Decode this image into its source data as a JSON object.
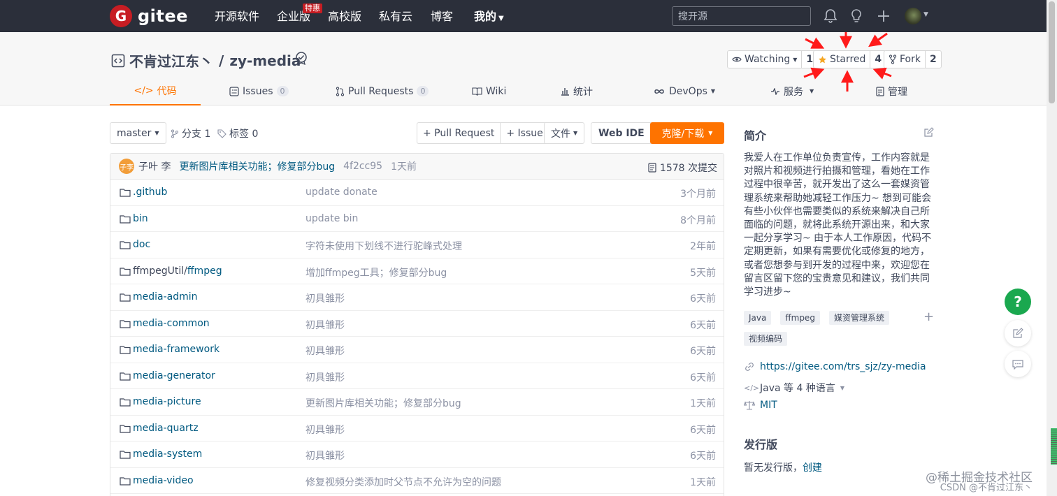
{
  "brand": {
    "logo_letter": "G",
    "name": "gitee"
  },
  "topnav": {
    "items": [
      "开源软件",
      "企业版",
      "高校版",
      "私有云",
      "博客",
      "我的"
    ],
    "badge": "特惠",
    "search_placeholder": "搜开源"
  },
  "repo": {
    "owner": "不肯过江东丶",
    "separator": "/",
    "name": "zy-media",
    "watching": {
      "label": "Watching",
      "count": "1"
    },
    "starred": {
      "label": "Starred",
      "count": "4"
    },
    "fork": {
      "label": "Fork",
      "count": "2"
    }
  },
  "tabs": [
    {
      "label": "代码",
      "count": ""
    },
    {
      "label": "Issues",
      "count": "0"
    },
    {
      "label": "Pull Requests",
      "count": "0"
    },
    {
      "label": "Wiki",
      "count": ""
    },
    {
      "label": "统计",
      "count": ""
    },
    {
      "label": "DevOps",
      "count": ""
    },
    {
      "label": "服务",
      "count": ""
    },
    {
      "label": "管理",
      "count": ""
    }
  ],
  "toolbar": {
    "branch": "master",
    "branches": "分支 1",
    "tags": "标签 0",
    "pull_request": "+ Pull Request",
    "issue": "+ Issue",
    "file": "文件",
    "web_ide": "Web IDE",
    "clone": "克隆/下载"
  },
  "commit": {
    "avatar_text": "子李",
    "author": "子叶 李",
    "message": "更新图片库相关功能；修复部分bug",
    "sha": "4f2cc95",
    "time": "1天前",
    "count": "1578 次提交"
  },
  "files": [
    {
      "name": ".github",
      "prefix": "",
      "message": "update donate",
      "time": "3个月前"
    },
    {
      "name": "bin",
      "prefix": "",
      "message": "update bin",
      "time": "8个月前"
    },
    {
      "name": "doc",
      "prefix": "",
      "message": "字符未使用下划线不进行驼峰式处理",
      "time": "2年前"
    },
    {
      "name": "ffmpeg",
      "prefix": "ffmpegUtil/",
      "message": "增加ffmpeg工具；修复部分bug",
      "time": "5天前"
    },
    {
      "name": "media-admin",
      "prefix": "",
      "message": "初具雏形",
      "time": "6天前"
    },
    {
      "name": "media-common",
      "prefix": "",
      "message": "初具雏形",
      "time": "6天前"
    },
    {
      "name": "media-framework",
      "prefix": "",
      "message": "初具雏形",
      "time": "6天前"
    },
    {
      "name": "media-generator",
      "prefix": "",
      "message": "初具雏形",
      "time": "6天前"
    },
    {
      "name": "media-picture",
      "prefix": "",
      "message": "更新图片库相关功能；修复部分bug",
      "time": "1天前"
    },
    {
      "name": "media-quartz",
      "prefix": "",
      "message": "初具雏形",
      "time": "6天前"
    },
    {
      "name": "media-system",
      "prefix": "",
      "message": "初具雏形",
      "time": "6天前"
    },
    {
      "name": "media-video",
      "prefix": "",
      "message": "修复视频分类添加时父节点不允许为空的问题",
      "time": "1天前"
    }
  ],
  "sidebar": {
    "intro_title": "简介",
    "description": "我爱人在工作单位负责宣传，工作内容就是对照片和视频进行拍摄和管理，看她在工作过程中很辛苦，就开发出了这么一套媒资管理系统来帮助她减轻工作压力~ 想到可能会有些小伙伴也需要类似的系统来解决自己所面临的问题，就将此系统开源出来，和大家一起分享学习~ 由于本人工作原因，代码不定期更新，如果有需要优化或修复的地方，或者您想参与到开发的过程中来，欢迎您在留言区留下您的宝贵意见和建议，我们共同学习进步~",
    "tags": [
      "Java",
      "ffmpeg",
      "媒资管理系统",
      "视频编码"
    ],
    "url": "https://gitee.com/trs_sjz/zy-media",
    "language": "Java 等 4 种语言",
    "license": "MIT",
    "release_title": "发行版",
    "release_none": "暂无发行版，",
    "release_create": "创建"
  },
  "fab": {
    "help": "?"
  },
  "watermark": {
    "line1": "@稀土掘金技术社区",
    "line2": "CSDN @不肯过江东丶"
  },
  "colors": {
    "accent": "#fe7300",
    "nav_bg": "#2b2f3a",
    "link": "#005980",
    "annotation_arrow": "#ff1a1a"
  }
}
